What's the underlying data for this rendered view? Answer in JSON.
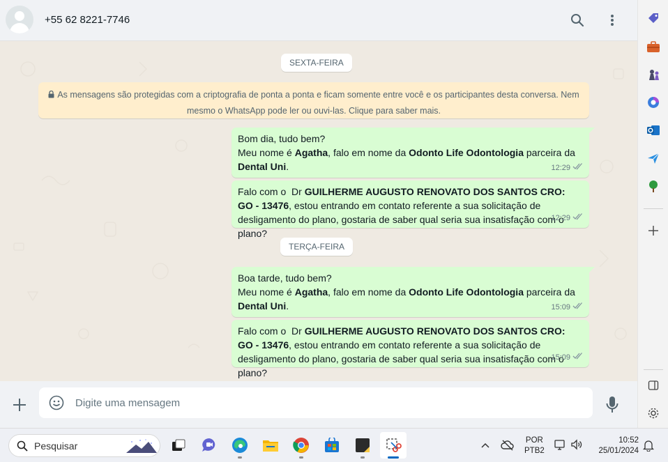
{
  "header": {
    "contact_name": "+55 62 8221-7746",
    "icons": [
      "search-icon",
      "menu-dots-icon"
    ]
  },
  "messages": {
    "date_1": "SEXTA-FEIRA",
    "encryption_notice_line1": "As mensagens são protegidas com a criptografia de ponta a ponta e ficam somente entre você e os participantes desta conversa. Nem",
    "encryption_notice_line2": "mesmo o WhatsApp pode ler ou ouvi-las. Clique para saber mais.",
    "msg1": {
      "line1": "Bom dia, tudo bem?",
      "line2_pre": "Meu nome é ",
      "name": "Agatha",
      "line2_mid": ", falo em nome da ",
      "company": "Odonto Life Odontologia",
      "line2_post": " parceira da",
      "partner": "Dental Uni",
      "end": ".",
      "time": "12:29"
    },
    "msg2": {
      "pre": "Falo com o  Dr ",
      "doctor": "GUILHERME AUGUSTO RENOVATO DOS SANTOS CRO: GO - 13476",
      "post": ", estou entrando em contato referente a sua solicitação de desligamento do plano, gostaria de saber qual seria sua insatisfação com o plano?",
      "time": "12:29"
    },
    "date_2": "TERÇA-FEIRA",
    "msg3": {
      "line1": "Boa tarde, tudo bem?",
      "line2_pre": "Meu nome é ",
      "name": "Agatha",
      "line2_mid": ", falo em nome da ",
      "company": "Odonto Life Odontologia",
      "line2_post": " parceira da",
      "partner": "Dental Uni",
      "end": ".",
      "time": "15:09"
    },
    "msg4": {
      "pre": "Falo com o  Dr ",
      "doctor": "GUILHERME AUGUSTO RENOVATO DOS SANTOS CRO: GO - 13476",
      "post": ", estou entrando em contato referente a sua solicitação de desligamento do plano, gostaria de saber qual seria sua insatisfação com o plano?",
      "time": "15:09"
    }
  },
  "composer": {
    "placeholder": "Digite uma mensagem"
  },
  "taskbar": {
    "search_label": "Pesquisar",
    "lang_line1": "POR",
    "lang_line2": "PTB2",
    "time": "10:52",
    "date": "25/01/2024"
  },
  "colors": {
    "outgoing_bubble": "#d9fdd3",
    "notice_bg": "#ffeecd",
    "chat_bg": "#efeae2",
    "read_ticks": "#8696a0"
  }
}
